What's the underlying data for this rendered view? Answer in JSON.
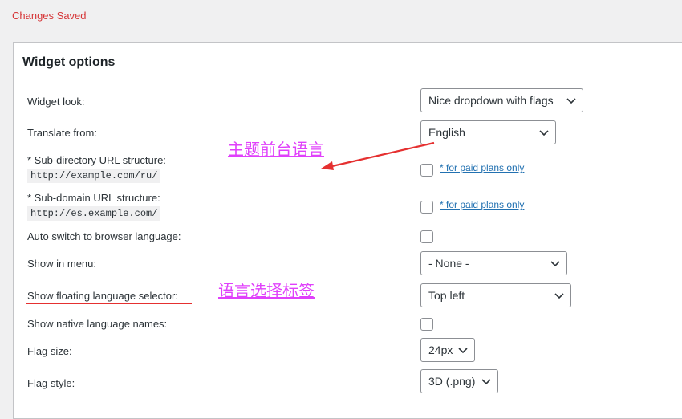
{
  "status": {
    "message": "Changes Saved",
    "color": "#d63638"
  },
  "panel": {
    "title": "Widget options"
  },
  "rows": {
    "widget_look": {
      "label": "Widget look:",
      "value": "Nice dropdown with flags"
    },
    "translate_from": {
      "label": "Translate from:",
      "value": "English"
    },
    "subdirectory": {
      "label": "* Sub-directory URL structure:",
      "example": "http://example.com/ru/",
      "link": "* for paid plans only"
    },
    "subdomain": {
      "label": "* Sub-domain URL structure:",
      "example": "http://es.example.com/",
      "link": "* for paid plans only"
    },
    "auto_switch": {
      "label": "Auto switch to browser language:"
    },
    "show_in_menu": {
      "label": "Show in menu:",
      "value": "- None -"
    },
    "floating_selector": {
      "label": "Show floating language selector:",
      "value": "Top left"
    },
    "native_names": {
      "label": "Show native language names:"
    },
    "flag_size": {
      "label": "Flag size:",
      "value": "24px"
    },
    "flag_style": {
      "label": "Flag style:",
      "value": "3D (.png)"
    }
  },
  "annotations": {
    "theme_language": "主题前台语言",
    "language_selector_label": "语言选择标签",
    "annotation_color": "#e040fb",
    "arrow_color": "#e53030"
  },
  "icons": {
    "select_arrow": "chevron-down-icon"
  }
}
